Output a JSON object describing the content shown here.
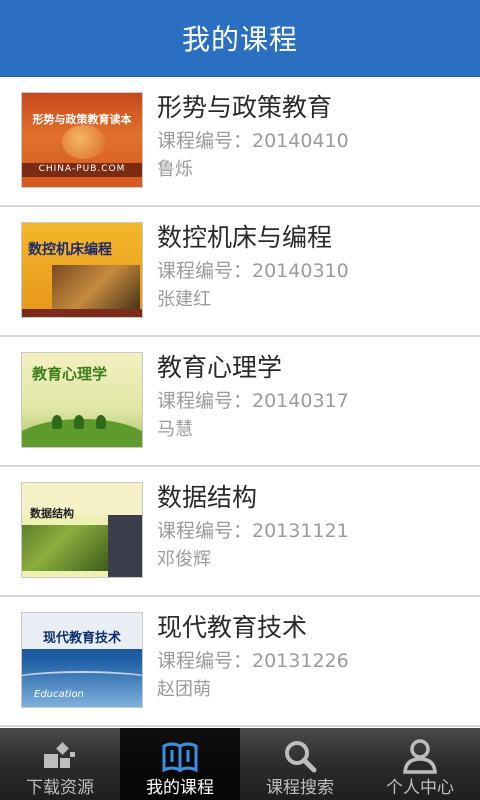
{
  "header": {
    "title": "我的课程"
  },
  "courses": [
    {
      "title": "形势与政策教育",
      "code_label": "课程编号：20140410",
      "teacher": "鲁烁",
      "cover": {
        "title": "形势与政策教育读本",
        "footer": "CHINA-PUB.COM"
      }
    },
    {
      "title": "数控机床与编程",
      "code_label": "课程编号：20140310",
      "teacher": "张建红",
      "cover": {
        "title": "数控机床编程"
      }
    },
    {
      "title": "教育心理学",
      "code_label": "课程编号：20140317",
      "teacher": "马慧",
      "cover": {
        "title": "教育心理学"
      }
    },
    {
      "title": "数据结构",
      "code_label": "课程编号：20131121",
      "teacher": "邓俊辉",
      "cover": {
        "title": "数据结构"
      }
    },
    {
      "title": "现代教育技术",
      "code_label": "课程编号：20131226",
      "teacher": "赵团萌",
      "cover": {
        "title": "现代教育技术",
        "subtitle": "Education"
      }
    }
  ],
  "tabbar": {
    "tabs": [
      {
        "label": "下载资源",
        "icon": "download-resources-icon",
        "active": false
      },
      {
        "label": "我的课程",
        "icon": "book-icon",
        "active": true
      },
      {
        "label": "课程搜索",
        "icon": "search-icon",
        "active": false
      },
      {
        "label": "个人中心",
        "icon": "user-icon",
        "active": false
      }
    ]
  },
  "colors": {
    "header": "#2b6fc2",
    "tabbar": "#2c2c2c",
    "active_tab": "#050505"
  }
}
